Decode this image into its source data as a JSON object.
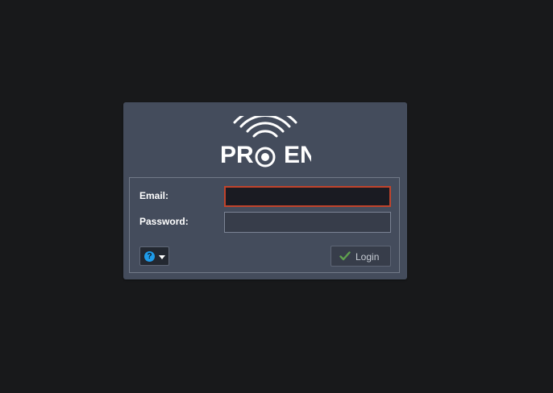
{
  "brand": {
    "logo_text_left": "PR",
    "logo_text_right": "EN"
  },
  "form": {
    "email_label": "Email:",
    "email_value": "",
    "password_label": "Password:",
    "password_value": "",
    "help_icon_glyph": "?",
    "login_label": "Login"
  },
  "icons": {
    "help": "help-icon",
    "dropdown": "caret-down-icon",
    "login": "check-icon"
  },
  "colors": {
    "page_background": "#18191b",
    "panel_background": "#444c5c",
    "email_focus_border": "#c1432b",
    "help_icon": "#1e9be9",
    "check_icon": "#5fa04e"
  }
}
